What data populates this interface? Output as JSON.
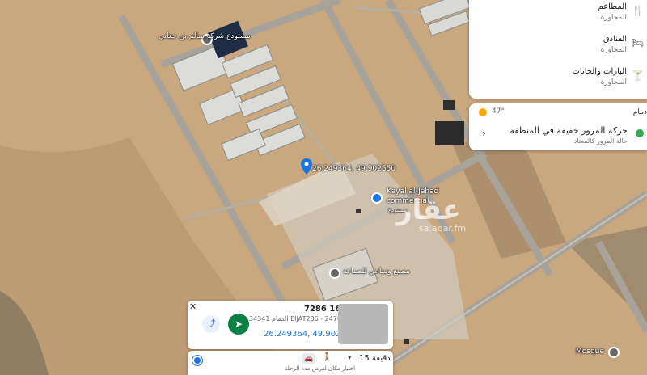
{
  "map": {
    "labels": {
      "factory_north": "مستودع شركة سالم بن جعاني",
      "coords_label": "26.249364, 49.902550",
      "kayal_line1": "Kayal al-Jehad",
      "kayal_line2": "commercial",
      "kayal_sub": "مستودع",
      "factory_south": "مصنع وساعي للصناعة",
      "mosque": "Mosque"
    },
    "watermark": {
      "arabic": "عقار",
      "english": "sa.aqar.fm"
    }
  },
  "nearby_panel": {
    "items": [
      {
        "title": "المطاعم",
        "subtitle": "المجاورة",
        "icon": "restaurant-icon"
      },
      {
        "title": "الفنادق",
        "subtitle": "المجاورة",
        "icon": "hotel-icon"
      },
      {
        "title": "البارات والحانات",
        "subtitle": "المجاورة",
        "icon": "bar-icon"
      }
    ]
  },
  "traffic_card": {
    "header": "دمام",
    "temperature": "47°",
    "headline": "حركة المرور خفيفة في المنطقة",
    "subtitle": "حالة المرور كالمعتاد"
  },
  "place_card": {
    "title": "7286 16",
    "address": "34341 الدمام EIJAT286 - 2470",
    "coordinates": "26.249364, 49.902550",
    "close_label": "✕",
    "share_icon": "share-icon",
    "directions_icon": "directions-icon"
  },
  "route_bar": {
    "duration": "15 دقيقة",
    "hint": "اختيار مكان لعرض مدة الرحلة"
  },
  "colors": {
    "sand": "#c9a77f",
    "road": "#9a9a9a",
    "accent": "#1a73e8",
    "green": "#0b8043"
  }
}
